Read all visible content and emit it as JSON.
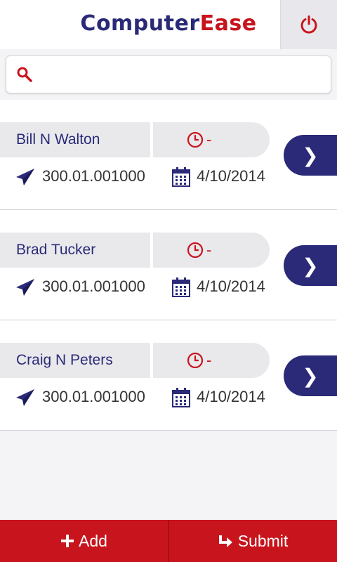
{
  "header": {
    "logo_part1": "Computer",
    "logo_part2": "Ease"
  },
  "search": {
    "value": "",
    "placeholder": ""
  },
  "entries": [
    {
      "name": "Bill N Walton",
      "status": "-",
      "code": "300.01.001000",
      "date": "4/10/2014"
    },
    {
      "name": "Brad Tucker",
      "status": "-",
      "code": "300.01.001000",
      "date": "4/10/2014"
    },
    {
      "name": "Craig N Peters",
      "status": "-",
      "code": "300.01.001000",
      "date": "4/10/2014"
    }
  ],
  "footer": {
    "add_label": "Add",
    "submit_label": "Submit"
  },
  "colors": {
    "brand_blue": "#2a2a78",
    "brand_red": "#c8141c"
  }
}
